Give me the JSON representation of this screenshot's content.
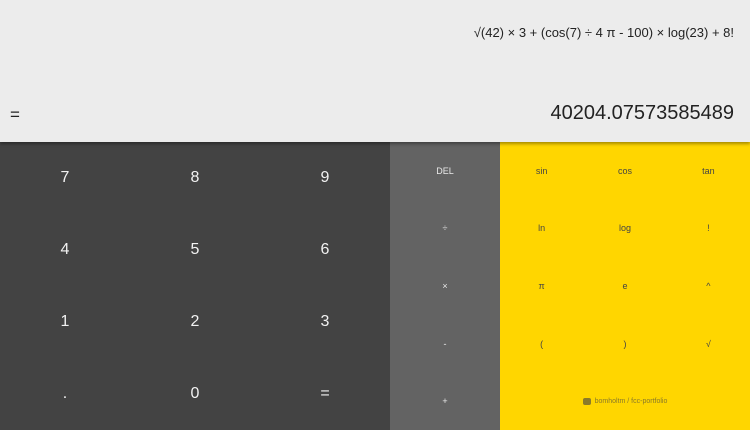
{
  "display": {
    "expression": "√(42) × 3 + (cos(7) ÷ 4 π - 100) × log(23) + 8!",
    "equals": "=",
    "result": "40204.07573585489"
  },
  "numpad": {
    "keys": [
      "7",
      "8",
      "9",
      "4",
      "5",
      "6",
      "1",
      "2",
      "3",
      ".",
      "0",
      "="
    ]
  },
  "operators": {
    "keys": [
      "DEL",
      "÷",
      "×",
      "-",
      "+"
    ]
  },
  "scientific": {
    "keys": [
      "sin",
      "cos",
      "tan",
      "ln",
      "log",
      "!",
      "π",
      "e",
      "^",
      "(",
      ")",
      "√"
    ]
  },
  "footer": {
    "link_text": "bomholtm / fcc-portfolio",
    "icon": "github-icon"
  },
  "colors": {
    "display_bg": "#ececec",
    "numpad_bg": "#434343",
    "operators_bg": "#636363",
    "scientific_bg": "#ffd600"
  }
}
